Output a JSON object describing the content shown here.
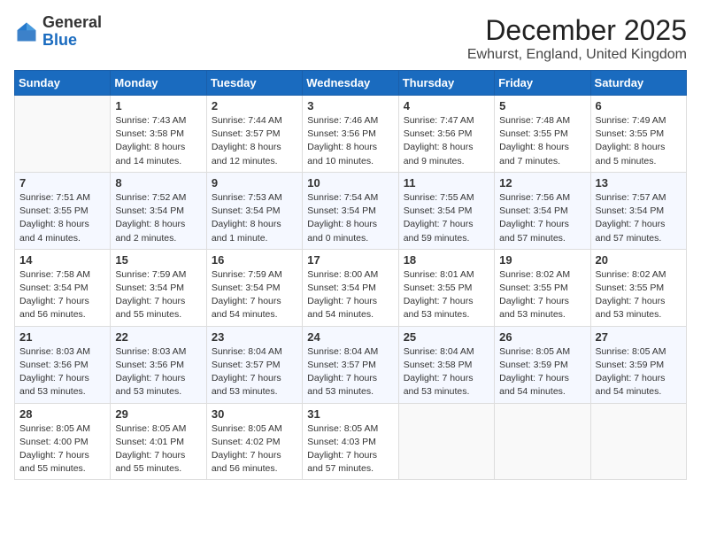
{
  "header": {
    "logo_general": "General",
    "logo_blue": "Blue",
    "month_title": "December 2025",
    "location": "Ewhurst, England, United Kingdom"
  },
  "days_of_week": [
    "Sunday",
    "Monday",
    "Tuesday",
    "Wednesday",
    "Thursday",
    "Friday",
    "Saturday"
  ],
  "weeks": [
    [
      {
        "day": "",
        "empty": true
      },
      {
        "day": "1",
        "sunrise": "Sunrise: 7:43 AM",
        "sunset": "Sunset: 3:58 PM",
        "daylight": "Daylight: 8 hours and 14 minutes."
      },
      {
        "day": "2",
        "sunrise": "Sunrise: 7:44 AM",
        "sunset": "Sunset: 3:57 PM",
        "daylight": "Daylight: 8 hours and 12 minutes."
      },
      {
        "day": "3",
        "sunrise": "Sunrise: 7:46 AM",
        "sunset": "Sunset: 3:56 PM",
        "daylight": "Daylight: 8 hours and 10 minutes."
      },
      {
        "day": "4",
        "sunrise": "Sunrise: 7:47 AM",
        "sunset": "Sunset: 3:56 PM",
        "daylight": "Daylight: 8 hours and 9 minutes."
      },
      {
        "day": "5",
        "sunrise": "Sunrise: 7:48 AM",
        "sunset": "Sunset: 3:55 PM",
        "daylight": "Daylight: 8 hours and 7 minutes."
      },
      {
        "day": "6",
        "sunrise": "Sunrise: 7:49 AM",
        "sunset": "Sunset: 3:55 PM",
        "daylight": "Daylight: 8 hours and 5 minutes."
      }
    ],
    [
      {
        "day": "7",
        "sunrise": "Sunrise: 7:51 AM",
        "sunset": "Sunset: 3:55 PM",
        "daylight": "Daylight: 8 hours and 4 minutes."
      },
      {
        "day": "8",
        "sunrise": "Sunrise: 7:52 AM",
        "sunset": "Sunset: 3:54 PM",
        "daylight": "Daylight: 8 hours and 2 minutes."
      },
      {
        "day": "9",
        "sunrise": "Sunrise: 7:53 AM",
        "sunset": "Sunset: 3:54 PM",
        "daylight": "Daylight: 8 hours and 1 minute."
      },
      {
        "day": "10",
        "sunrise": "Sunrise: 7:54 AM",
        "sunset": "Sunset: 3:54 PM",
        "daylight": "Daylight: 8 hours and 0 minutes."
      },
      {
        "day": "11",
        "sunrise": "Sunrise: 7:55 AM",
        "sunset": "Sunset: 3:54 PM",
        "daylight": "Daylight: 7 hours and 59 minutes."
      },
      {
        "day": "12",
        "sunrise": "Sunrise: 7:56 AM",
        "sunset": "Sunset: 3:54 PM",
        "daylight": "Daylight: 7 hours and 57 minutes."
      },
      {
        "day": "13",
        "sunrise": "Sunrise: 7:57 AM",
        "sunset": "Sunset: 3:54 PM",
        "daylight": "Daylight: 7 hours and 57 minutes."
      }
    ],
    [
      {
        "day": "14",
        "sunrise": "Sunrise: 7:58 AM",
        "sunset": "Sunset: 3:54 PM",
        "daylight": "Daylight: 7 hours and 56 minutes."
      },
      {
        "day": "15",
        "sunrise": "Sunrise: 7:59 AM",
        "sunset": "Sunset: 3:54 PM",
        "daylight": "Daylight: 7 hours and 55 minutes."
      },
      {
        "day": "16",
        "sunrise": "Sunrise: 7:59 AM",
        "sunset": "Sunset: 3:54 PM",
        "daylight": "Daylight: 7 hours and 54 minutes."
      },
      {
        "day": "17",
        "sunrise": "Sunrise: 8:00 AM",
        "sunset": "Sunset: 3:54 PM",
        "daylight": "Daylight: 7 hours and 54 minutes."
      },
      {
        "day": "18",
        "sunrise": "Sunrise: 8:01 AM",
        "sunset": "Sunset: 3:55 PM",
        "daylight": "Daylight: 7 hours and 53 minutes."
      },
      {
        "day": "19",
        "sunrise": "Sunrise: 8:02 AM",
        "sunset": "Sunset: 3:55 PM",
        "daylight": "Daylight: 7 hours and 53 minutes."
      },
      {
        "day": "20",
        "sunrise": "Sunrise: 8:02 AM",
        "sunset": "Sunset: 3:55 PM",
        "daylight": "Daylight: 7 hours and 53 minutes."
      }
    ],
    [
      {
        "day": "21",
        "sunrise": "Sunrise: 8:03 AM",
        "sunset": "Sunset: 3:56 PM",
        "daylight": "Daylight: 7 hours and 53 minutes."
      },
      {
        "day": "22",
        "sunrise": "Sunrise: 8:03 AM",
        "sunset": "Sunset: 3:56 PM",
        "daylight": "Daylight: 7 hours and 53 minutes."
      },
      {
        "day": "23",
        "sunrise": "Sunrise: 8:04 AM",
        "sunset": "Sunset: 3:57 PM",
        "daylight": "Daylight: 7 hours and 53 minutes."
      },
      {
        "day": "24",
        "sunrise": "Sunrise: 8:04 AM",
        "sunset": "Sunset: 3:57 PM",
        "daylight": "Daylight: 7 hours and 53 minutes."
      },
      {
        "day": "25",
        "sunrise": "Sunrise: 8:04 AM",
        "sunset": "Sunset: 3:58 PM",
        "daylight": "Daylight: 7 hours and 53 minutes."
      },
      {
        "day": "26",
        "sunrise": "Sunrise: 8:05 AM",
        "sunset": "Sunset: 3:59 PM",
        "daylight": "Daylight: 7 hours and 54 minutes."
      },
      {
        "day": "27",
        "sunrise": "Sunrise: 8:05 AM",
        "sunset": "Sunset: 3:59 PM",
        "daylight": "Daylight: 7 hours and 54 minutes."
      }
    ],
    [
      {
        "day": "28",
        "sunrise": "Sunrise: 8:05 AM",
        "sunset": "Sunset: 4:00 PM",
        "daylight": "Daylight: 7 hours and 55 minutes."
      },
      {
        "day": "29",
        "sunrise": "Sunrise: 8:05 AM",
        "sunset": "Sunset: 4:01 PM",
        "daylight": "Daylight: 7 hours and 55 minutes."
      },
      {
        "day": "30",
        "sunrise": "Sunrise: 8:05 AM",
        "sunset": "Sunset: 4:02 PM",
        "daylight": "Daylight: 7 hours and 56 minutes."
      },
      {
        "day": "31",
        "sunrise": "Sunrise: 8:05 AM",
        "sunset": "Sunset: 4:03 PM",
        "daylight": "Daylight: 7 hours and 57 minutes."
      },
      {
        "day": "",
        "empty": true
      },
      {
        "day": "",
        "empty": true
      },
      {
        "day": "",
        "empty": true
      }
    ]
  ]
}
